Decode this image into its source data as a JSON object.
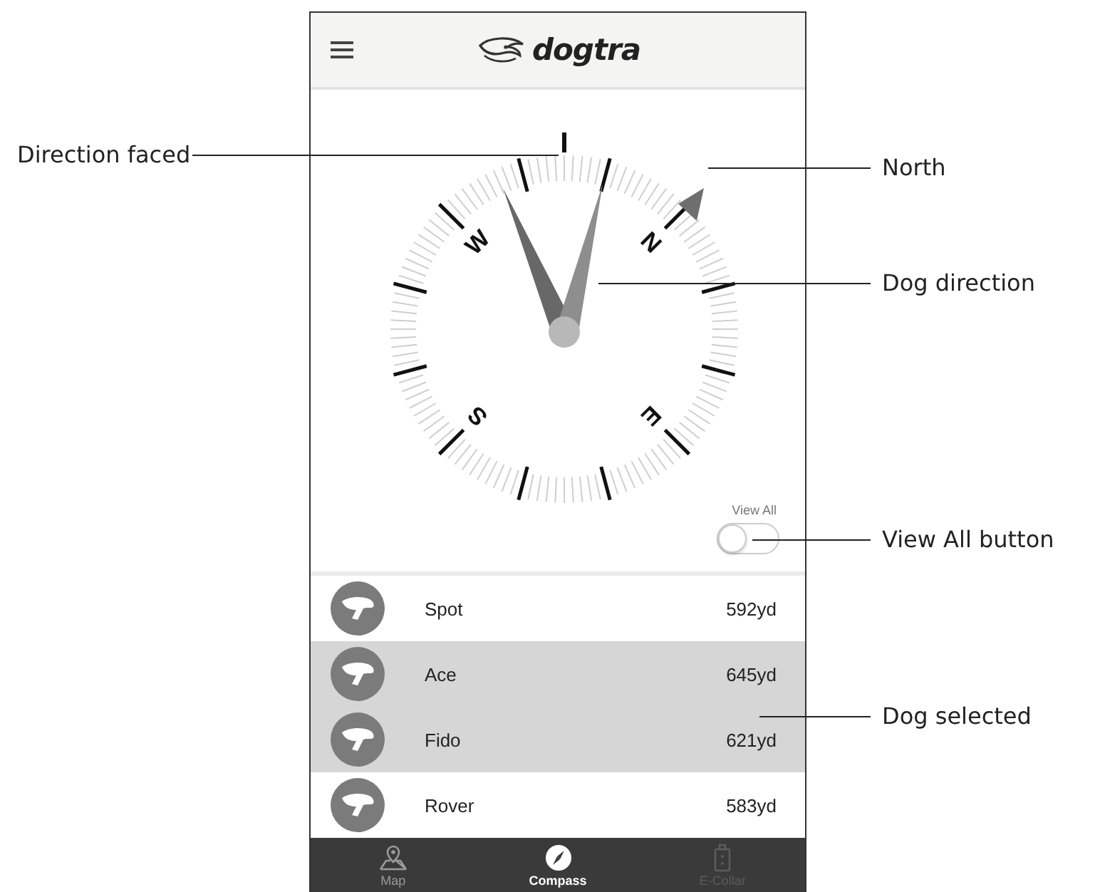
{
  "header": {
    "logo_text": "dogtra"
  },
  "compass": {
    "cardinals": [
      "N",
      "E",
      "S",
      "W"
    ]
  },
  "view_all": {
    "label": "View All",
    "on": false
  },
  "dogs": [
    {
      "name": "Spot",
      "distance": "592yd",
      "selected": false
    },
    {
      "name": "Ace",
      "distance": "645yd",
      "selected": true
    },
    {
      "name": "Fido",
      "distance": "621yd",
      "selected": true
    },
    {
      "name": "Rover",
      "distance": "583yd",
      "selected": false
    }
  ],
  "tabs": [
    {
      "label": "Map",
      "selected": false,
      "disabled": false
    },
    {
      "label": "Compass",
      "selected": true,
      "disabled": false
    },
    {
      "label": "E-Collar",
      "selected": false,
      "disabled": true
    }
  ],
  "annotations": [
    {
      "text": "Direction faced"
    },
    {
      "text": "North"
    },
    {
      "text": "Dog direction"
    },
    {
      "text": "View All button"
    },
    {
      "text": "Dog selected"
    }
  ]
}
